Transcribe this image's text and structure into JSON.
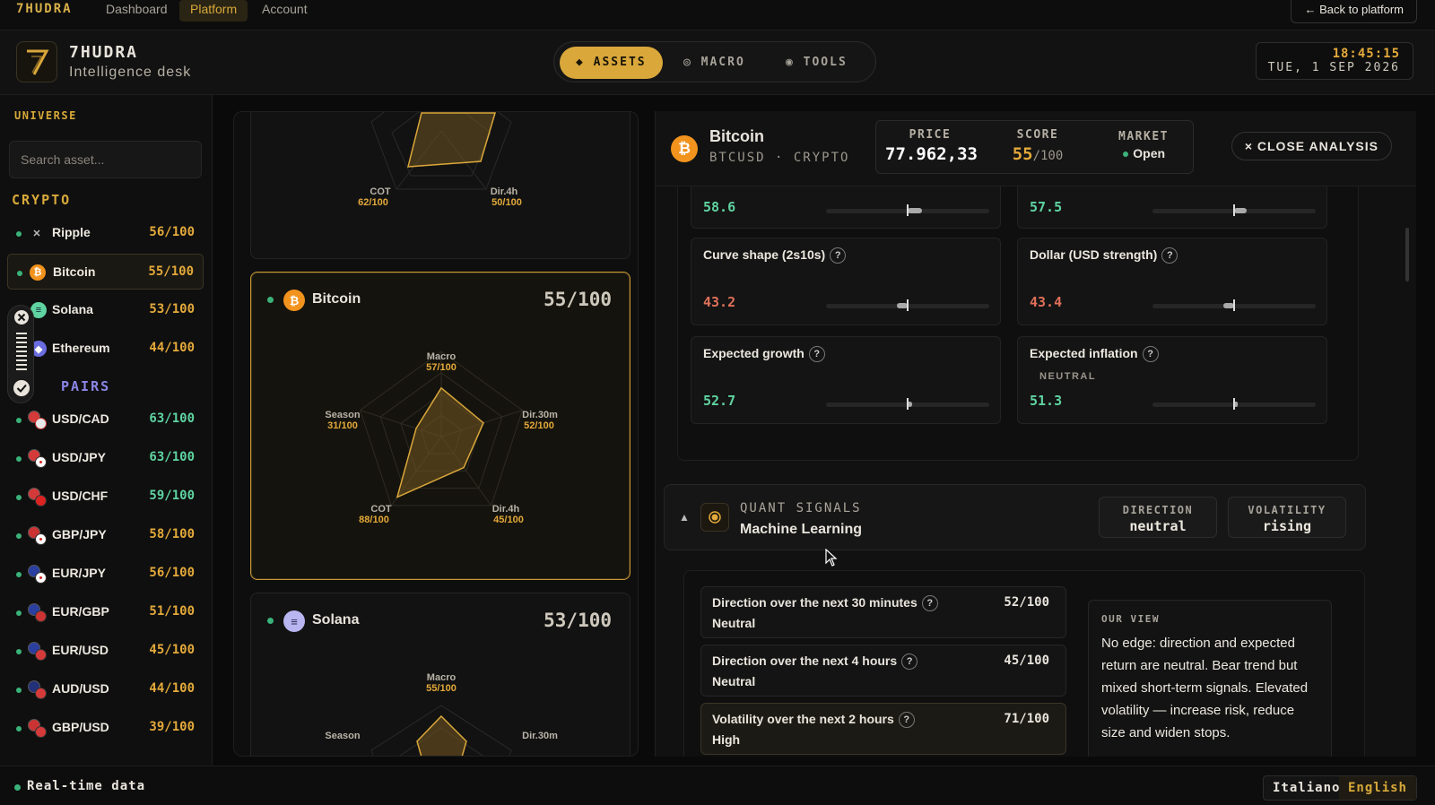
{
  "topnav": {
    "brand": "7HUDRA",
    "links": [
      {
        "label": "Dashboard"
      },
      {
        "label": "Platform"
      },
      {
        "label": "Account"
      }
    ],
    "back_label": "← Back to platform"
  },
  "header": {
    "brand_title": "7HUDRA",
    "brand_subtitle": "Intelligence desk",
    "mode_tabs": [
      {
        "label": "ASSETS"
      },
      {
        "label": "MACRO"
      },
      {
        "label": "TOOLS"
      }
    ],
    "clock_time": "18:45:15",
    "clock_date": "TUE, 1 SEP 2026"
  },
  "sidebar": {
    "universe_label": "UNIVERSE",
    "search_placeholder": "Search asset...",
    "crypto_label": "CRYPTO",
    "pairs_label": "PAIRS",
    "crypto": [
      {
        "name": "Ripple",
        "score": "56/100",
        "icon": "x-icon"
      },
      {
        "name": "Bitcoin",
        "score": "55/100",
        "icon": "bitcoin-icon",
        "selected": true
      },
      {
        "name": "Solana",
        "score": "53/100",
        "icon": "solana-icon"
      },
      {
        "name": "Ethereum",
        "score": "44/100",
        "icon": "ethereum-icon"
      }
    ],
    "pairs": [
      {
        "name": "USD/CAD",
        "score": "63/100"
      },
      {
        "name": "USD/JPY",
        "score": "63/100"
      },
      {
        "name": "USD/CHF",
        "score": "59/100"
      },
      {
        "name": "GBP/JPY",
        "score": "58/100"
      },
      {
        "name": "EUR/JPY",
        "score": "56/100"
      },
      {
        "name": "EUR/GBP",
        "score": "51/100"
      },
      {
        "name": "EUR/USD",
        "score": "45/100"
      },
      {
        "name": "AUD/USD",
        "score": "44/100"
      },
      {
        "name": "GBP/USD",
        "score": "39/100"
      }
    ]
  },
  "cards": {
    "top": {
      "labels": {
        "cot": "COT",
        "dir4h": "Dir.4h"
      },
      "values": {
        "cot": "62/100",
        "dir4h": "50/100"
      }
    },
    "bitcoin": {
      "name": "Bitcoin",
      "score": "55/100",
      "labels": {
        "macro": "Macro",
        "dir30m": "Dir.30m",
        "dir4h": "Dir.4h",
        "cot": "COT",
        "season": "Season"
      },
      "values": {
        "macro": "57/100",
        "dir30m": "52/100",
        "dir4h": "45/100",
        "cot": "88/100",
        "season": "31/100"
      },
      "radar": [
        57,
        52,
        45,
        88,
        31
      ]
    },
    "solana": {
      "name": "Solana",
      "score": "53/100",
      "labels": {
        "macro": "Macro",
        "season": "Season",
        "dir30m": "Dir.30m"
      },
      "values": {
        "macro": "55/100"
      }
    }
  },
  "analysis": {
    "name": "Bitcoin",
    "ticker": "BTCUSD · CRYPTO",
    "price_label": "PRICE",
    "price": "77.962,33",
    "score_label": "SCORE",
    "score": "55",
    "score_suffix": "/100",
    "market_label": "MARKET",
    "market": "Open",
    "close_label": "× CLOSE ANALYSIS",
    "macro_cards": [
      {
        "title": "",
        "value": "58.6",
        "level": 58.6
      },
      {
        "title": "",
        "value": "57.5",
        "level": 57.5
      },
      {
        "title": "Curve shape (2s10s)",
        "value": "43.2",
        "level": 43.2
      },
      {
        "title": "Dollar (USD strength)",
        "value": "43.4",
        "level": 43.4
      },
      {
        "title": "Expected growth",
        "value": "52.7",
        "level": 52.7
      },
      {
        "title": "Expected inflation",
        "subtitle": "NEUTRAL",
        "value": "51.3",
        "level": 51.3
      }
    ],
    "quant": {
      "kicker": "QUANT SIGNALS",
      "title": "Machine Learning",
      "direction_label": "DIRECTION",
      "direction": "neutral",
      "volatility_label": "VOLATILITY",
      "volatility": "rising"
    },
    "signals": [
      {
        "title": "Direction over the next 30 minutes",
        "state": "Neutral",
        "score": "52/100"
      },
      {
        "title": "Direction over the next 4 hours",
        "state": "Neutral",
        "score": "45/100"
      },
      {
        "title": "Volatility over the next 2 hours",
        "state": "High",
        "score": "71/100"
      }
    ],
    "view_label": "OUR VIEW",
    "view_text": "No edge: direction and expected return are neutral. Bear trend but mixed short-term signals. Elevated volatility — increase risk, reduce size and widen stops."
  },
  "footer": {
    "status": "Real-time data",
    "languages": [
      {
        "label": "Italiano"
      },
      {
        "label": "English"
      }
    ]
  },
  "colors": {
    "accent": "#d9a73a",
    "positive": "#5fd3a1",
    "negative": "#e0705a",
    "live": "#3bb27a"
  }
}
